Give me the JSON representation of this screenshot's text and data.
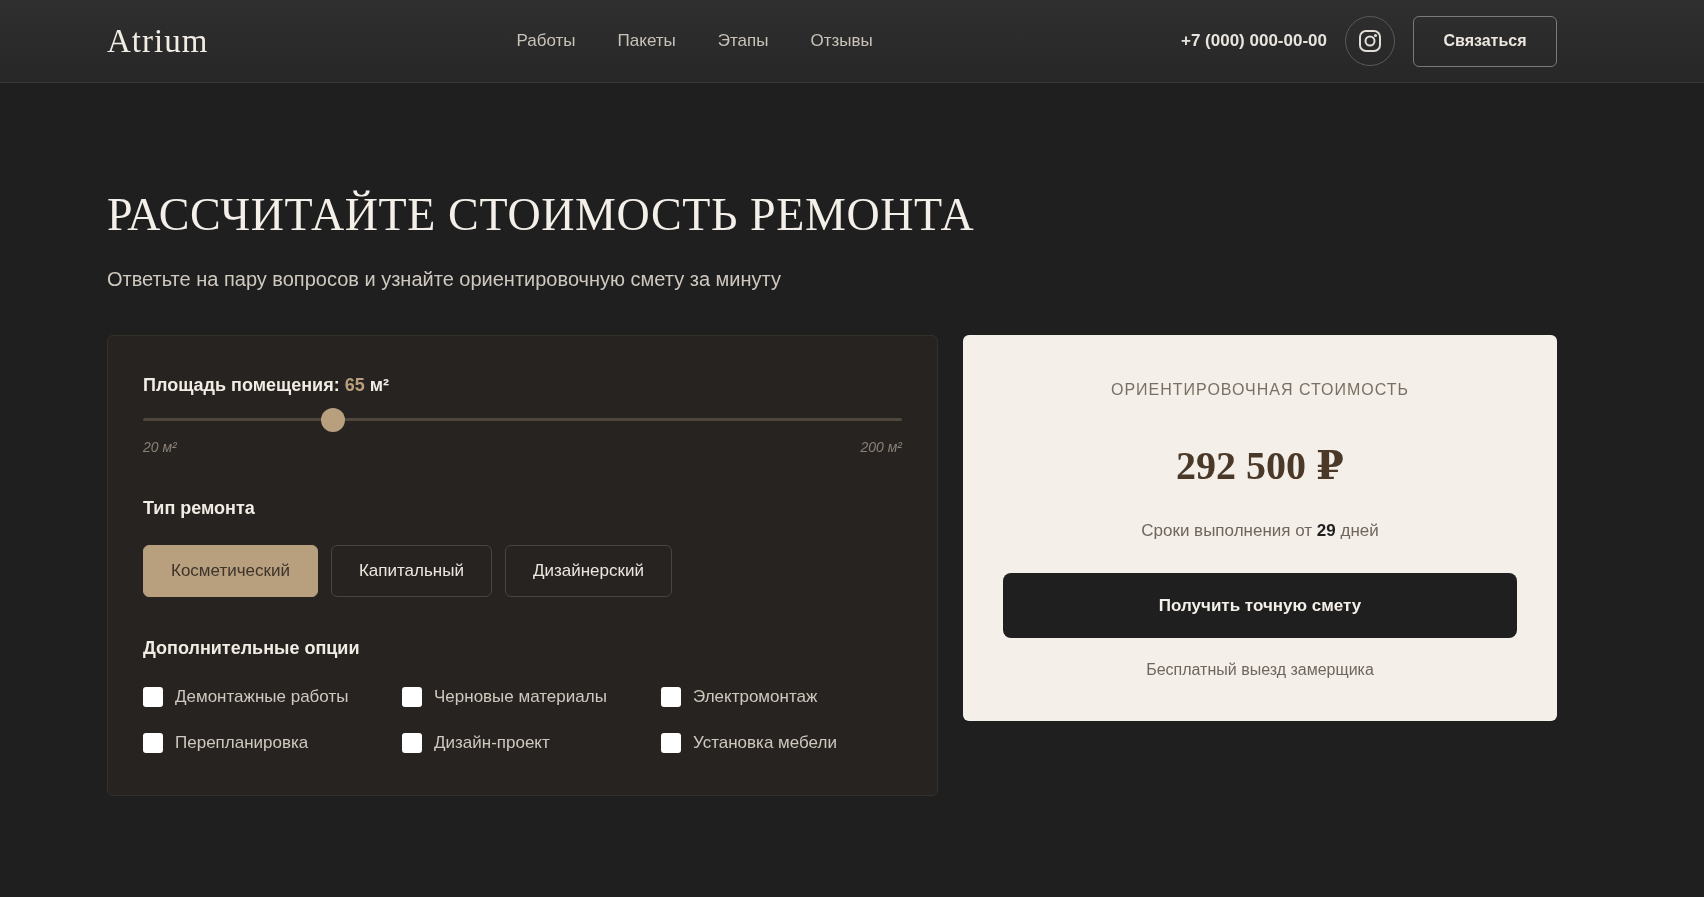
{
  "header": {
    "logo": "Atrium",
    "nav": [
      "Работы",
      "Пакеты",
      "Этапы",
      "Отзывы"
    ],
    "phone": "+7 (000) 000-00-00",
    "contact_button": "Связаться"
  },
  "hero": {
    "title": "РАССЧИТАЙТЕ СТОИМОСТЬ РЕМОНТА",
    "subtitle": "Ответьте на пару вопросов и узнайте ориентировочную смету за минуту"
  },
  "calculator": {
    "area": {
      "label": "Площадь помещения:",
      "value": "65",
      "unit": "м²",
      "level": 0.25,
      "min_label": "20 м²",
      "max_label": "200 м²"
    },
    "repair_type": {
      "label": "Тип ремонта",
      "options": [
        {
          "label": "Косметический",
          "selected": true
        },
        {
          "label": "Капитальный",
          "selected": false
        },
        {
          "label": "Дизайнерский",
          "selected": false
        }
      ]
    },
    "extras": {
      "label": "Дополнительные опции",
      "options": [
        {
          "label": "Демонтажные работы",
          "checked": false
        },
        {
          "label": "Черновые материалы",
          "checked": false
        },
        {
          "label": "Электромонтаж",
          "checked": false
        },
        {
          "label": "Перепланировка",
          "checked": false
        },
        {
          "label": "Дизайн-проект",
          "checked": false
        },
        {
          "label": "Установка мебели",
          "checked": false
        }
      ]
    }
  },
  "estimate": {
    "label": "ОРИЕНТИРОВОЧНАЯ СТОИМОСТЬ",
    "price": "292 500 ₽",
    "duration": "Сроки выполнения от **29** дней",
    "button": "Получить точную смету",
    "note": "Бесплатный выезд замерщика"
  }
}
